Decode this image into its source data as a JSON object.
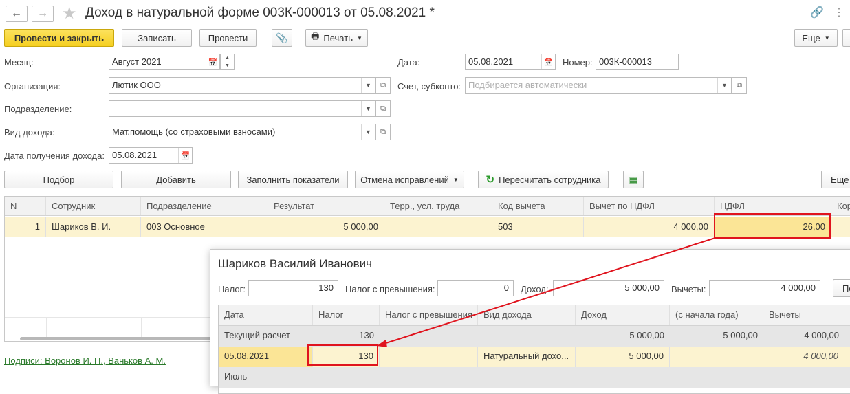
{
  "header": {
    "title": "Доход в натуральной форме 003К-000013 от 05.08.2021 *"
  },
  "toolbar": {
    "post_close": "Провести и закрыть",
    "save": "Записать",
    "post": "Провести",
    "print": "Печать",
    "more": "Еще"
  },
  "form": {
    "month_label": "Месяц:",
    "month_value": "Август 2021",
    "date_label": "Дата:",
    "date_value": "05.08.2021",
    "number_label": "Номер:",
    "number_value": "003К-000013",
    "org_label": "Организация:",
    "org_value": "Лютик ООО",
    "account_label": "Счет, субконто:",
    "account_placeholder": "Подбирается автоматически",
    "dept_label": "Подразделение:",
    "dept_value": "",
    "income_type_label": "Вид дохода:",
    "income_type_value": "Мат.помощь (со страховыми взносами)",
    "income_date_label": "Дата получения дохода:",
    "income_date_value": "05.08.2021"
  },
  "table_toolbar": {
    "select": "Подбор",
    "add": "Добавить",
    "fill": "Заполнить показатели",
    "cancel_corr": "Отмена исправлений",
    "recalc": "Пересчитать сотрудника",
    "more": "Еще"
  },
  "main_table": {
    "headers": [
      "N",
      "Сотрудник",
      "Подразделение",
      "Результат",
      "Терр., усл. труда",
      "Код вычета",
      "Вычет по НДФЛ",
      "НДФЛ",
      "Кор"
    ],
    "row": {
      "n": "1",
      "employee": "Шариков В. И.",
      "dept": "003 Основное",
      "result": "5 000,00",
      "terr": "",
      "code": "503",
      "deduction": "4 000,00",
      "ndfl": "26,00"
    }
  },
  "signatures_link": "Подписи: Воронов И. П., Ваньков А. М.",
  "popup": {
    "title": "Шариков Василий Иванович",
    "tax_label": "Налог:",
    "tax_value": "130",
    "excess_label": "Налог с превышения:",
    "excess_value": "0",
    "income_label": "Доход:",
    "income_value": "5 000,00",
    "deductions_label": "Вычеты:",
    "deductions_value": "4 000,00",
    "cut_button": "По",
    "headers": [
      "Дата",
      "Налог",
      "Налог с превышения",
      "Вид дохода",
      "Доход",
      "(с начала года)",
      "Вычеты"
    ],
    "rows": [
      {
        "date": "Текущий расчет",
        "tax": "130",
        "excess": "",
        "kind": "",
        "income": "5 000,00",
        "ytd": "5 000,00",
        "deductions": "4 000,00"
      },
      {
        "date": "05.08.2021",
        "tax": "130",
        "excess": "",
        "kind": "Натуральный дохо...",
        "income": "5 000,00",
        "ytd": "",
        "deductions": "4 000,00"
      },
      {
        "date": "Июль",
        "tax": "",
        "excess": "",
        "kind": "",
        "income": "",
        "ytd": "",
        "deductions": ""
      }
    ]
  },
  "colors": {
    "primary": "#f5cf21",
    "selected_row": "#fcf3d0",
    "selected_cell": "#fbe596",
    "highlight": "#e0141e",
    "link": "#2a7a2a"
  }
}
